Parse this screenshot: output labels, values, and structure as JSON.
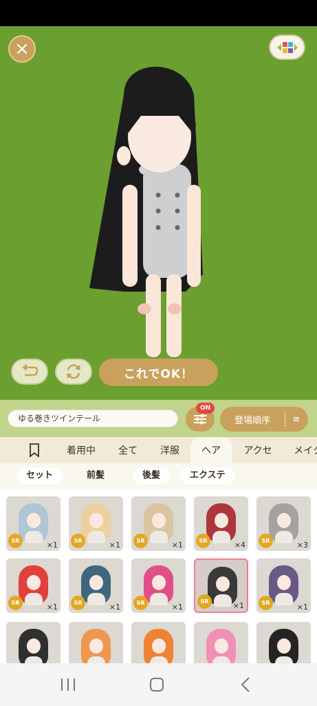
{
  "header": {
    "close_icon": "close-icon",
    "color_icon": "color-palette-icon"
  },
  "actions": {
    "undo_icon": "undo-icon",
    "rotate_icon": "rotate-icon",
    "ok_label": "これでOK！"
  },
  "toolbar": {
    "item_name": "ゆる巻きツインテール",
    "filter_icon": "sliders-icon",
    "filter_badge": "ON",
    "sort_label": "登場順序",
    "sort_icon": "sort-icon"
  },
  "tabs": [
    "着用中",
    "全て",
    "洋服",
    "ヘア",
    "アクセ",
    "メイク"
  ],
  "active_tab": "ヘア",
  "subtabs": [
    "セット",
    "前髪",
    "後髪",
    "エクステ"
  ],
  "active_subtab": "前髪",
  "items": [
    {
      "rarity": "SR",
      "count": "×1",
      "hair_color": "#a9c4d6"
    },
    {
      "rarity": "SR",
      "count": "×1",
      "hair_color": "#eecf9a"
    },
    {
      "rarity": "SR",
      "count": "×1",
      "hair_color": "#d8c49a"
    },
    {
      "rarity": "SR",
      "count": "×4",
      "hair_color": "#a8262a"
    },
    {
      "rarity": "SR",
      "count": "×3",
      "hair_color": "#9d9b98"
    },
    {
      "rarity": "SR",
      "count": "×1",
      "hair_color": "#e2302a"
    },
    {
      "rarity": "SR",
      "count": "×1",
      "hair_color": "#2f5b73"
    },
    {
      "rarity": "SR",
      "count": "×1",
      "hair_color": "#e0407c"
    },
    {
      "rarity": "SR",
      "count": "×1",
      "hair_color": "#2a2a2a",
      "selected": true
    },
    {
      "rarity": "SR",
      "count": "×1",
      "hair_color": "#5b4b7d"
    },
    {
      "rarity": "",
      "count": "",
      "hair_color": "#1e1e1e"
    },
    {
      "rarity": "",
      "count": "",
      "hair_color": "#f09040"
    },
    {
      "rarity": "",
      "count": "",
      "hair_color": "#f07a25"
    },
    {
      "rarity": "",
      "count": "",
      "hair_color": "#f08ab0"
    },
    {
      "rarity": "",
      "count": "",
      "hair_color": "#111111"
    }
  ],
  "system_nav": {
    "recents_icon": "recents-icon",
    "home_icon": "home-icon",
    "back_icon": "back-icon"
  }
}
